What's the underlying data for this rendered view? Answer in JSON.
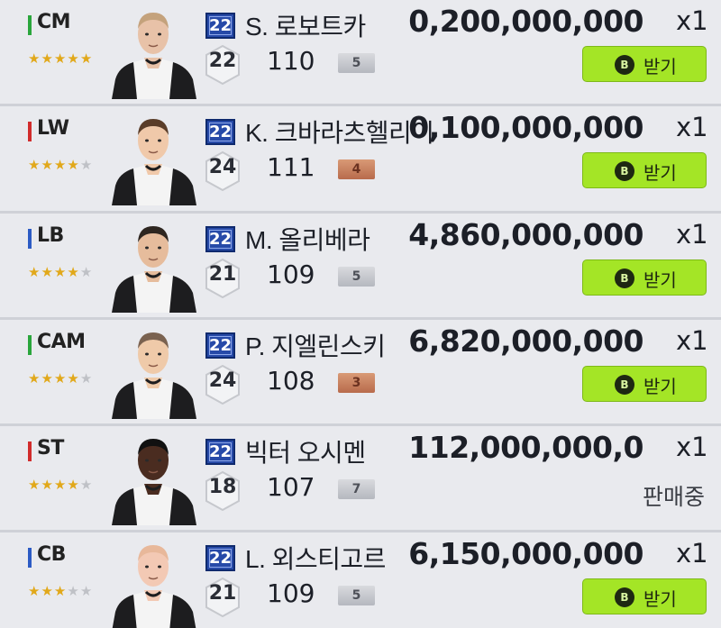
{
  "receive_label": "받기",
  "coin_glyph": "B",
  "colors": {
    "cm_bar": "#2aa63c",
    "lw_bar": "#d12c2c",
    "lb_bar": "#2c5bc4",
    "button": "#a4e526"
  },
  "players": [
    {
      "position": "CM",
      "pos_color": "#2aa63c",
      "stars": 5,
      "season": "22",
      "name": "S. 로보트카",
      "ovr_level": "22",
      "rating": "110",
      "enhance": "5",
      "enhance_tier": "silver",
      "price": "0,200,000,000",
      "qty": "x1",
      "action": "button"
    },
    {
      "position": "LW",
      "pos_color": "#d12c2c",
      "stars": 4,
      "season": "22",
      "name": "K. 크바라츠헬리이",
      "ovr_level": "24",
      "rating": "111",
      "enhance": "4",
      "enhance_tier": "bronze",
      "price": "0,100,000,000",
      "qty": "x1",
      "action": "button"
    },
    {
      "position": "LB",
      "pos_color": "#2c5bc4",
      "stars": 4,
      "season": "22",
      "name": "M. 올리베라",
      "ovr_level": "21",
      "rating": "109",
      "enhance": "5",
      "enhance_tier": "silver",
      "price": "4,860,000,000",
      "qty": "x1",
      "action": "button"
    },
    {
      "position": "CAM",
      "pos_color": "#2aa63c",
      "stars": 4,
      "season": "22",
      "name": "P. 지엘린스키",
      "ovr_level": "24",
      "rating": "108",
      "enhance": "3",
      "enhance_tier": "bronze",
      "price": "6,820,000,000",
      "qty": "x1",
      "action": "button"
    },
    {
      "position": "ST",
      "pos_color": "#d12c2c",
      "stars": 4,
      "season": "22",
      "name": "빅터 오시멘",
      "ovr_level": "18",
      "rating": "107",
      "enhance": "7",
      "enhance_tier": "silver",
      "price": "112,000,000,0",
      "qty": "x1",
      "action": "status",
      "status": "판매중"
    },
    {
      "position": "CB",
      "pos_color": "#2c5bc4",
      "stars": 3,
      "season": "22",
      "name": "L. 외스티고르",
      "ovr_level": "21",
      "rating": "109",
      "enhance": "5",
      "enhance_tier": "silver",
      "price": "6,150,000,000",
      "qty": "x1",
      "action": "button"
    }
  ]
}
